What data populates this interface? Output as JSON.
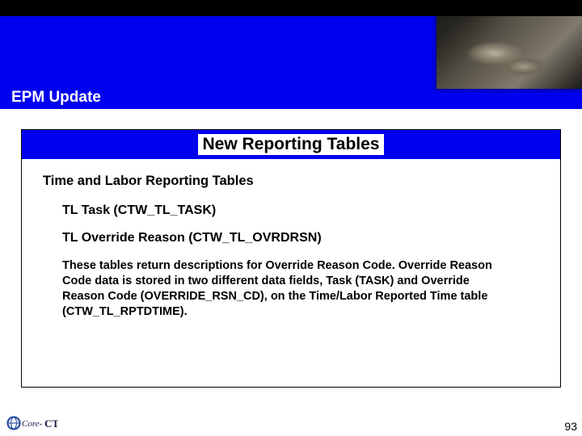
{
  "banner": {
    "title": "EPM Update"
  },
  "content": {
    "header": "New Reporting Tables",
    "section_title": "Time and Labor Reporting Tables",
    "tables": [
      "TL Task (CTW_TL_TASK)",
      "TL Override Reason (CTW_TL_OVRDRSN)"
    ],
    "description": "These tables return descriptions for Override Reason Code.  Override Reason Code data is stored in two different data fields, Task (TASK) and Override Reason Code (OVERRIDE_RSN_CD), on the Time/Labor Reported Time table (CTW_TL_RPTDTIME)."
  },
  "footer": {
    "logo_text": "Core-CT",
    "page_number": "93"
  }
}
